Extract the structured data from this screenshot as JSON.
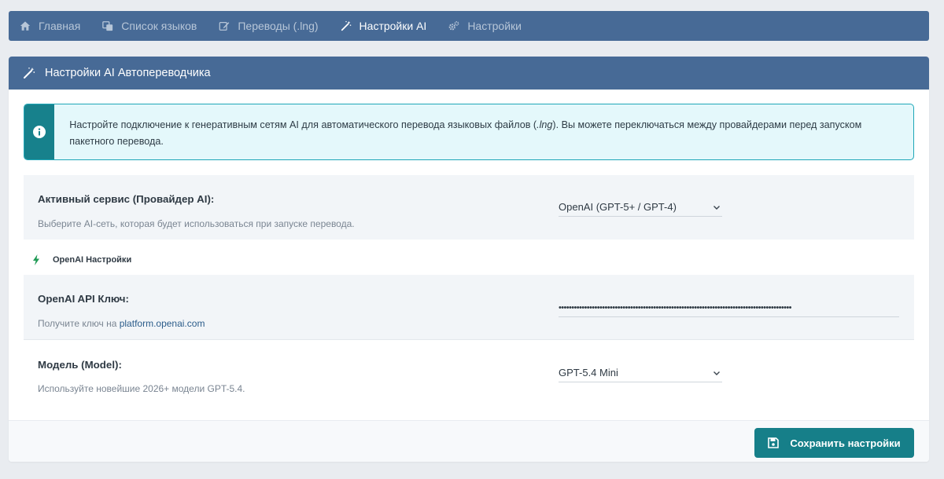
{
  "nav": {
    "items": [
      {
        "label": "Главная",
        "icon": "home-icon"
      },
      {
        "label": "Список языков",
        "icon": "language-icon"
      },
      {
        "label": "Переводы (.lng)",
        "icon": "edit-icon"
      },
      {
        "label": "Настройки AI",
        "icon": "magic-wand-icon",
        "active": true
      },
      {
        "label": "Настройки",
        "icon": "gears-icon"
      }
    ]
  },
  "card": {
    "title": "Настройки AI Автопереводчика",
    "alert": {
      "text_before": "Настройте подключение к генеративным сетям AI для автоматического перевода языковых файлов (",
      "text_italic": ".lng",
      "text_after": "). Вы можете переключаться между провайдерами перед запуском пакетного перевода."
    },
    "provider": {
      "label": "Активный сервис (Провайдер AI):",
      "hint": "Выберите AI-сеть, которая будет использоваться при запуске перевода.",
      "selected": "OpenAI (GPT-5+ / GPT-4)"
    },
    "section_title": "OpenAI Настройки",
    "api_key": {
      "label": "OpenAI API Ключ:",
      "hint_prefix": "Получите ключ на",
      "hint_link": "platform.openai.com",
      "masked_value": "•••••••••••••••••••••••••••••••••••••••••••••••••••••••••••••••••••••••••••••••••••••••••••"
    },
    "model": {
      "label": "Модель (Model):",
      "hint": "Используйте новейшие 2026+ модели GPT-5.4.",
      "selected": "GPT-5.4 Mini"
    },
    "save_label": "Сохранить настройки"
  },
  "colors": {
    "nav_bg": "#476a96",
    "accent_teal": "#167f89",
    "alert_bg": "#e4f8fb",
    "alert_border": "#1ea7b8",
    "bolt_green": "#1f9a55"
  }
}
